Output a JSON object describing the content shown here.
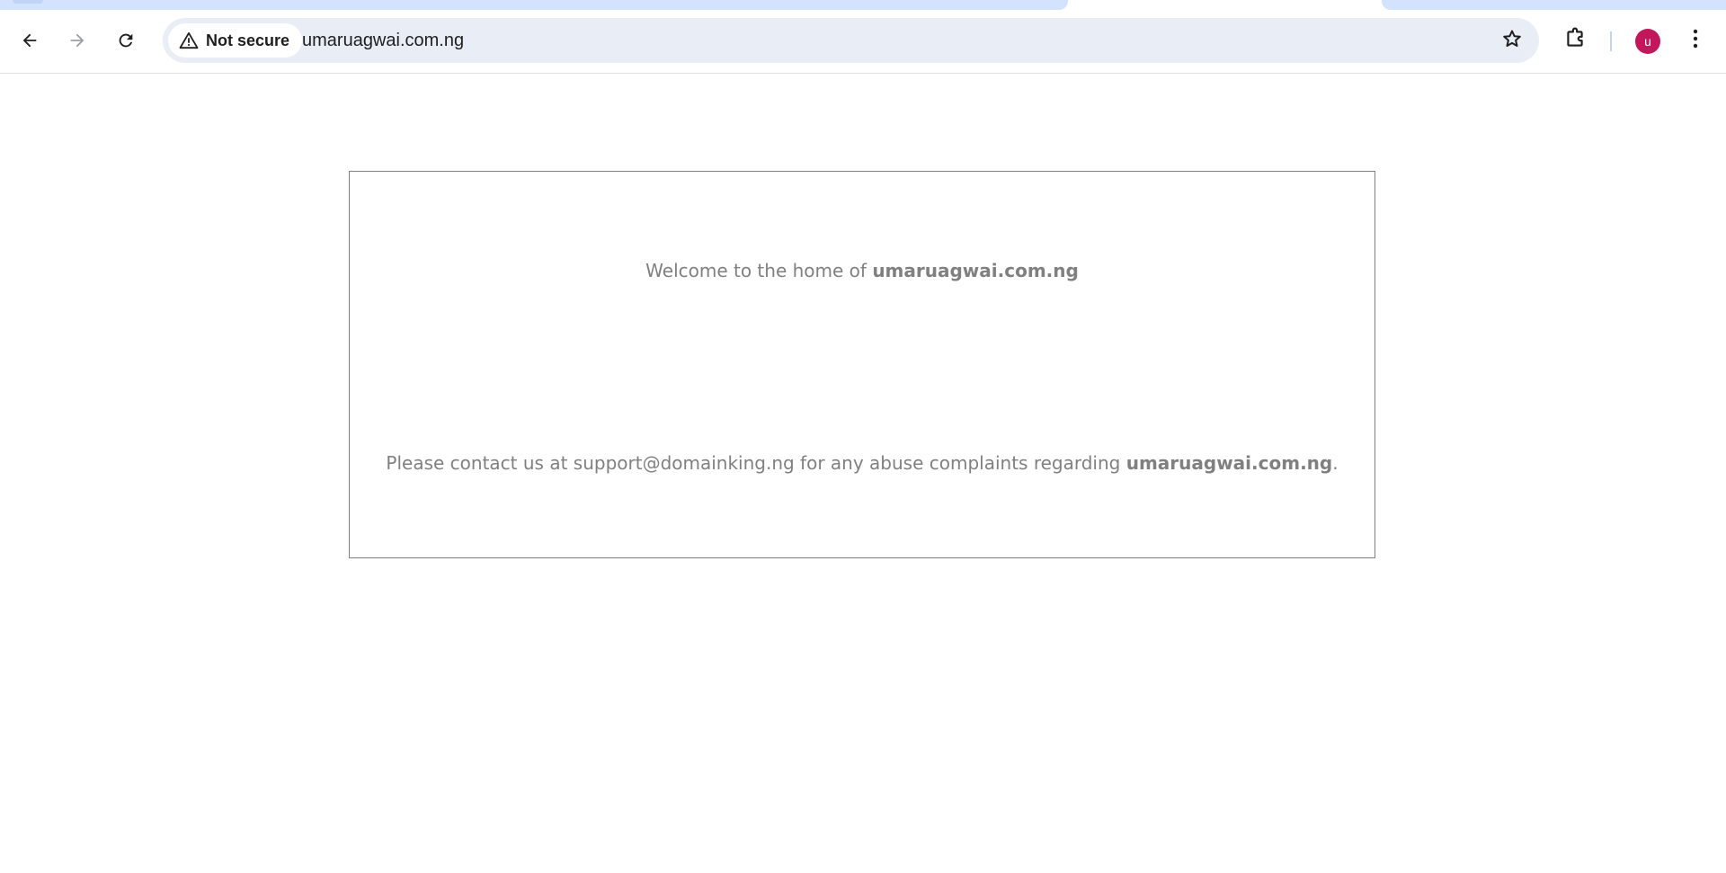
{
  "browser": {
    "security_label": "Not secure",
    "url": "umaruagwai.com.ng",
    "profile_initial": "u",
    "colors": {
      "tab_strip": "#d3e3fd",
      "omnibox": "#e9eef6",
      "avatar": "#c2185b"
    },
    "icons": {
      "back": "back-arrow-icon",
      "forward": "forward-arrow-icon",
      "reload": "reload-icon",
      "warning": "warning-icon",
      "bookmark": "star-icon",
      "extensions": "puzzle-icon",
      "menu": "kebab-menu-icon"
    }
  },
  "page": {
    "welcome_prefix": "Welcome to the home of ",
    "welcome_domain": "umaruagwai.com.ng",
    "contact_prefix": "Please contact us at support@domainking.ng for any abuse complaints regarding ",
    "contact_domain": "umaruagwai.com.ng",
    "contact_suffix": ".",
    "text_color": "#808080"
  }
}
